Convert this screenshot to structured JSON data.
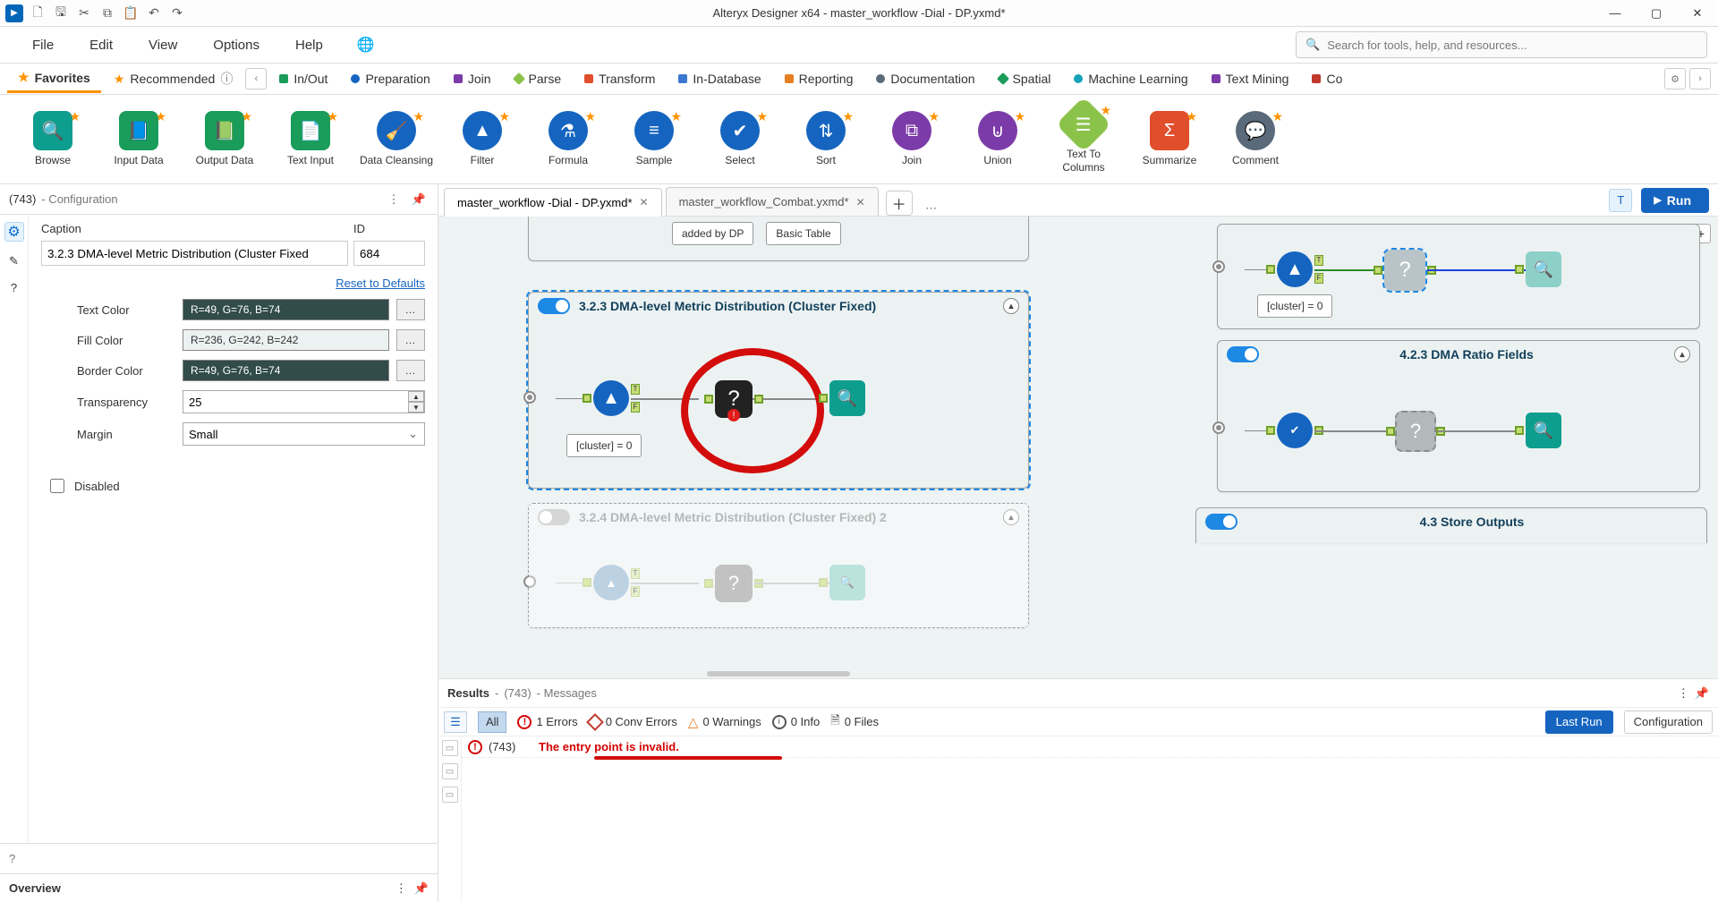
{
  "titlebar": {
    "title": "Alteryx Designer x64 - master_workflow -Dial - DP.yxmd*"
  },
  "menubar": {
    "items": [
      "File",
      "Edit",
      "View",
      "Options",
      "Help"
    ],
    "search_placeholder": "Search for tools, help, and resources..."
  },
  "ribbon": {
    "tabs": [
      {
        "label": "Favorites",
        "star": true,
        "active": true
      },
      {
        "label": "Recommended",
        "star": true
      },
      {
        "label": "In/Out",
        "color": "#1a9c5a"
      },
      {
        "label": "Preparation",
        "color": "#1565c0"
      },
      {
        "label": "Join",
        "color": "#7b3ba8"
      },
      {
        "label": "Parse",
        "color": "#8bc34a"
      },
      {
        "label": "Transform",
        "color": "#e04e2b"
      },
      {
        "label": "In-Database",
        "color": "#3b77d1"
      },
      {
        "label": "Reporting",
        "color": "#e67e22"
      },
      {
        "label": "Documentation",
        "color": "#5a6a7a"
      },
      {
        "label": "Spatial",
        "color": "#1a9c5a"
      },
      {
        "label": "Machine Learning",
        "color": "#17a2b8"
      },
      {
        "label": "Text Mining",
        "color": "#7b3ba8"
      },
      {
        "label": "Co",
        "color": "#c0392b"
      }
    ]
  },
  "palette": {
    "tools": [
      {
        "label": "Browse",
        "glyph": "🔍"
      },
      {
        "label": "Input Data",
        "glyph": "📘"
      },
      {
        "label": "Output Data",
        "glyph": "📗"
      },
      {
        "label": "Text Input",
        "glyph": "📄"
      },
      {
        "label": "Data Cleansing",
        "glyph": "🧹"
      },
      {
        "label": "Filter",
        "glyph": "▲"
      },
      {
        "label": "Formula",
        "glyph": "⚗"
      },
      {
        "label": "Sample",
        "glyph": "≡"
      },
      {
        "label": "Select",
        "glyph": "✔"
      },
      {
        "label": "Sort",
        "glyph": "⇅"
      },
      {
        "label": "Join",
        "glyph": "⧉"
      },
      {
        "label": "Union",
        "glyph": "⊍"
      },
      {
        "label": "Text To\nColumns",
        "glyph": "☰"
      },
      {
        "label": "Summarize",
        "glyph": "Σ"
      },
      {
        "label": "Comment",
        "glyph": "💬"
      }
    ]
  },
  "config_panel": {
    "header_id": "(743)",
    "header_text": "- Configuration",
    "caption_label": "Caption",
    "id_label": "ID",
    "caption_value": "3.2.3 DMA-level Metric Distribution (Cluster Fixed",
    "id_value": "684",
    "reset_link": "Reset to Defaults",
    "rows": {
      "text_color": {
        "label": "Text Color",
        "value": "R=49, G=76, B=74",
        "hex": "#314c4a"
      },
      "fill_color": {
        "label": "Fill Color",
        "value": "R=236, G=242, B=242",
        "hex": "#ecf2f2"
      },
      "border_color": {
        "label": "Border Color",
        "value": "R=49, G=76, B=74",
        "hex": "#314c4a"
      },
      "transparency": {
        "label": "Transparency",
        "value": "25"
      },
      "margin": {
        "label": "Margin",
        "value": "Small"
      }
    },
    "disabled_label": "Disabled"
  },
  "doc_tabs": {
    "tabs": [
      {
        "label": "master_workflow -Dial - DP.yxmd*",
        "active": true
      },
      {
        "label": "master_workflow_Combat.yxmd*",
        "active": false
      }
    ],
    "run_label": "Run"
  },
  "canvas": {
    "top_boxes": [
      "added by DP",
      "Basic Table"
    ],
    "c1": {
      "title": "3.2.3 DMA-level Metric Distribution (Cluster Fixed)",
      "cluster": "[cluster] = 0"
    },
    "c2": {
      "title": "3.2.4 DMA-level Metric Distribution (Cluster Fixed) 2"
    },
    "r1": {
      "cluster": "[cluster] = 0"
    },
    "r2": {
      "title": "4.2.3 DMA Ratio Fields"
    },
    "r3": {
      "title": "4.3 Store Outputs"
    }
  },
  "results": {
    "header_prefix": "Results",
    "header_id": "(743)",
    "header_suffix": "- Messages",
    "filters": {
      "all": "All",
      "errors_count": "1 Errors",
      "conv_errors": "0 Conv Errors",
      "warnings": "0 Warnings",
      "info": "0 Info",
      "files": "0 Files"
    },
    "lastrun": "Last Run",
    "config": "Configuration",
    "row": {
      "id": "(743)",
      "msg": "The entry point is invalid."
    }
  },
  "overview": {
    "title": "Overview"
  }
}
